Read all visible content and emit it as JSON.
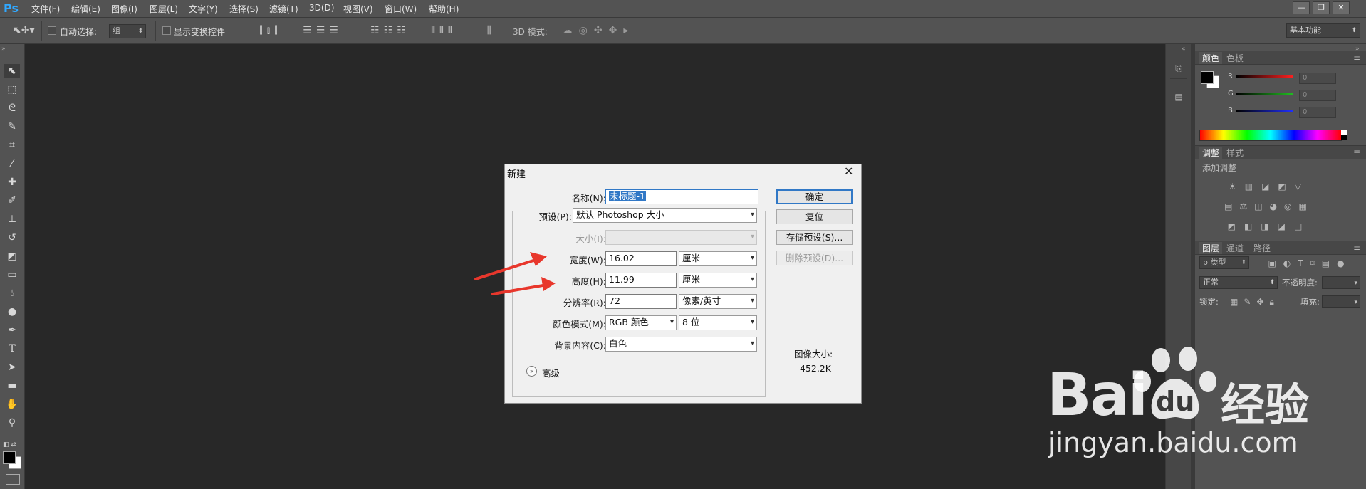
{
  "app": {
    "logo": "Ps",
    "menu": [
      "文件(F)",
      "编辑(E)",
      "图像(I)",
      "图层(L)",
      "文字(Y)",
      "选择(S)",
      "滤镜(T)",
      "3D(D)",
      "视图(V)",
      "窗口(W)",
      "帮助(H)"
    ],
    "window_buttons": [
      "—",
      "❐",
      "✕"
    ]
  },
  "options_bar": {
    "auto_select_label": "自动选择:",
    "auto_select_value": "组",
    "show_transform_label": "显示变换控件",
    "mode_3d_label": "3D 模式:",
    "workspace": "基本功能"
  },
  "color_panel": {
    "tabs": [
      "颜色",
      "色板"
    ],
    "channels": [
      {
        "label": "R",
        "value": "0",
        "color": "#ff2020"
      },
      {
        "label": "G",
        "value": "0",
        "color": "#20c020"
      },
      {
        "label": "B",
        "value": "0",
        "color": "#2030ff"
      }
    ]
  },
  "adjust_panel": {
    "tabs": [
      "调整",
      "样式"
    ],
    "title": "添加调整"
  },
  "layers_panel": {
    "tabs": [
      "图层",
      "通道",
      "路径"
    ],
    "filter": "ρ 类型",
    "blend_mode": "正常",
    "opacity_label": "不透明度:",
    "lock_label": "锁定:",
    "fill_label": "填充:"
  },
  "dialog": {
    "title": "新建",
    "name_label": "名称(N):",
    "name_value": "未标题-1",
    "preset_label": "预设(P):",
    "preset_value": "默认 Photoshop 大小",
    "size_label": "大小(I):",
    "width_label": "宽度(W):",
    "width_value": "16.02",
    "width_unit": "厘米",
    "height_label": "高度(H):",
    "height_value": "11.99",
    "height_unit": "厘米",
    "resolution_label": "分辨率(R):",
    "resolution_value": "72",
    "resolution_unit": "像素/英寸",
    "color_mode_label": "颜色模式(M):",
    "color_mode_value": "RGB 颜色",
    "bit_depth": "8 位",
    "background_label": "背景内容(C):",
    "background_value": "白色",
    "advanced_label": "高级",
    "ok": "确定",
    "reset": "复位",
    "save_preset": "存储预设(S)...",
    "delete_preset": "删除预设(D)...",
    "image_size_label": "图像大小:",
    "image_size_value": "452.2K"
  },
  "watermark": {
    "brand_left": "Bai",
    "brand_mid": "du",
    "brand_right": "经验",
    "url": "jingyan.baidu.com"
  },
  "colors": {
    "accent_arrow": "#e8372c",
    "selection": "#3178c6"
  }
}
